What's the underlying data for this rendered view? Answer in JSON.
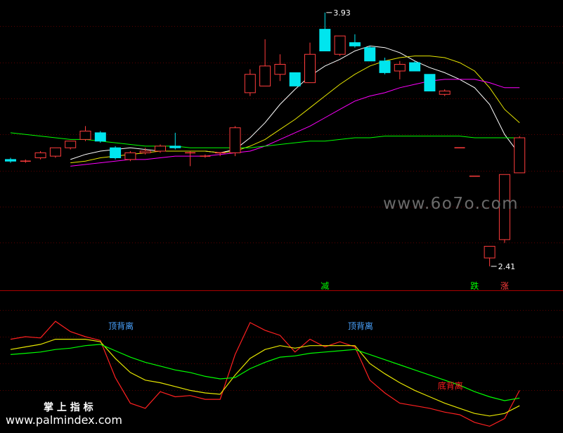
{
  "chart_data": [
    {
      "type": "candlestick",
      "title": "",
      "xlabel": "",
      "ylabel": "",
      "ylim": [
        2.3,
        3.98
      ],
      "grid": true,
      "colors": {
        "up": "#ff3c3c",
        "down": "#00e5ee",
        "background": "#000000",
        "grid": "#5a0000"
      },
      "candles": [
        {
          "o": 3.05,
          "h": 3.06,
          "l": 3.03,
          "c": 3.04
        },
        {
          "o": 3.04,
          "h": 3.05,
          "l": 3.03,
          "c": 3.04
        },
        {
          "o": 3.06,
          "h": 3.1,
          "l": 3.05,
          "c": 3.09
        },
        {
          "o": 3.07,
          "h": 3.12,
          "l": 3.06,
          "c": 3.12
        },
        {
          "o": 3.12,
          "h": 3.16,
          "l": 3.11,
          "c": 3.16
        },
        {
          "o": 3.17,
          "h": 3.25,
          "l": 3.16,
          "c": 3.22
        },
        {
          "o": 3.21,
          "h": 3.22,
          "l": 3.15,
          "c": 3.16
        },
        {
          "o": 3.12,
          "h": 3.13,
          "l": 3.05,
          "c": 3.06
        },
        {
          "o": 3.05,
          "h": 3.1,
          "l": 3.04,
          "c": 3.09
        },
        {
          "o": 3.09,
          "h": 3.12,
          "l": 3.08,
          "c": 3.1
        },
        {
          "o": 3.1,
          "h": 3.14,
          "l": 3.09,
          "c": 3.13
        },
        {
          "o": 3.13,
          "h": 3.21,
          "l": 3.11,
          "c": 3.12
        },
        {
          "o": 3.09,
          "h": 3.1,
          "l": 3.01,
          "c": 3.09
        },
        {
          "o": 3.07,
          "h": 3.08,
          "l": 3.06,
          "c": 3.07
        },
        {
          "o": 3.09,
          "h": 3.09,
          "l": 3.07,
          "c": 3.09
        },
        {
          "o": 3.09,
          "h": 3.25,
          "l": 3.07,
          "c": 3.24
        },
        {
          "o": 3.45,
          "h": 3.59,
          "l": 3.43,
          "c": 3.56
        },
        {
          "o": 3.49,
          "h": 3.77,
          "l": 3.49,
          "c": 3.61
        },
        {
          "o": 3.56,
          "h": 3.68,
          "l": 3.52,
          "c": 3.62
        },
        {
          "o": 3.57,
          "h": 3.57,
          "l": 3.49,
          "c": 3.49
        },
        {
          "o": 3.51,
          "h": 3.75,
          "l": 3.51,
          "c": 3.68
        },
        {
          "o": 3.83,
          "h": 3.93,
          "l": 3.7,
          "c": 3.7
        },
        {
          "o": 3.68,
          "h": 3.79,
          "l": 3.67,
          "c": 3.79
        },
        {
          "o": 3.75,
          "h": 3.8,
          "l": 3.72,
          "c": 3.73
        },
        {
          "o": 3.72,
          "h": 3.73,
          "l": 3.64,
          "c": 3.64
        },
        {
          "o": 3.64,
          "h": 3.66,
          "l": 3.56,
          "c": 3.57
        },
        {
          "o": 3.58,
          "h": 3.64,
          "l": 3.53,
          "c": 3.62
        },
        {
          "o": 3.63,
          "h": 3.64,
          "l": 3.58,
          "c": 3.58
        },
        {
          "o": 3.56,
          "h": 3.56,
          "l": 3.46,
          "c": 3.46
        },
        {
          "o": 3.44,
          "h": 3.47,
          "l": 3.43,
          "c": 3.46
        },
        {
          "o": 3.12,
          "h": 3.12,
          "l": 3.12,
          "c": 3.12
        },
        {
          "o": 2.95,
          "h": 2.95,
          "l": 2.95,
          "c": 2.95
        },
        {
          "o": 2.46,
          "h": 2.53,
          "l": 2.41,
          "c": 2.53
        },
        {
          "o": 2.57,
          "h": 2.96,
          "l": 2.55,
          "c": 2.96
        },
        {
          "o": 2.97,
          "h": 3.19,
          "l": 2.97,
          "c": 3.18
        }
      ],
      "series": [
        {
          "color": "#ffffff",
          "values": [
            null,
            null,
            null,
            null,
            3.05,
            3.08,
            3.1,
            3.11,
            3.12,
            3.11,
            3.1,
            3.1,
            3.1,
            3.1,
            3.09,
            3.11,
            3.18,
            3.27,
            3.38,
            3.47,
            3.55,
            3.61,
            3.65,
            3.7,
            3.73,
            3.72,
            3.69,
            3.64,
            3.6,
            3.57,
            3.53,
            3.48,
            3.38,
            3.2,
            3.08
          ]
        },
        {
          "color": "#e6e600",
          "values": [
            null,
            null,
            null,
            null,
            3.03,
            3.04,
            3.06,
            3.07,
            3.08,
            3.09,
            3.1,
            3.1,
            3.1,
            3.1,
            3.09,
            3.1,
            3.13,
            3.17,
            3.23,
            3.29,
            3.36,
            3.43,
            3.5,
            3.56,
            3.61,
            3.64,
            3.66,
            3.67,
            3.67,
            3.66,
            3.63,
            3.58,
            3.48,
            3.35,
            3.27
          ]
        },
        {
          "color": "#ff00ff",
          "values": [
            null,
            null,
            null,
            null,
            3.01,
            3.02,
            3.03,
            3.04,
            3.05,
            3.05,
            3.06,
            3.07,
            3.07,
            3.07,
            3.08,
            3.09,
            3.1,
            3.13,
            3.17,
            3.21,
            3.25,
            3.3,
            3.35,
            3.4,
            3.43,
            3.45,
            3.48,
            3.5,
            3.52,
            3.53,
            3.53,
            3.53,
            3.51,
            3.48,
            3.48
          ]
        },
        {
          "color": "#00ff00",
          "values": [
            3.21,
            3.2,
            3.19,
            3.18,
            3.17,
            3.17,
            3.16,
            3.15,
            3.14,
            3.13,
            3.13,
            3.13,
            3.12,
            3.12,
            3.12,
            3.12,
            3.12,
            3.13,
            3.14,
            3.15,
            3.16,
            3.16,
            3.17,
            3.18,
            3.18,
            3.19,
            3.19,
            3.19,
            3.19,
            3.19,
            3.19,
            3.18,
            3.18,
            3.18,
            3.18
          ]
        }
      ],
      "annotations": [
        {
          "text": "3.93",
          "index": 21,
          "value": 3.93
        },
        {
          "text": "2.41",
          "index": 32,
          "value": 2.41
        }
      ],
      "signals": [
        {
          "text": "减",
          "color": "#00ff00",
          "index": 21
        },
        {
          "text": "跌",
          "color": "#00ff00",
          "index": 31
        },
        {
          "text": "涨",
          "color": "#ff3c3c",
          "index": 33
        }
      ]
    },
    {
      "type": "line",
      "title": "",
      "xlabel": "",
      "ylabel": "",
      "ylim": [
        0,
        100
      ],
      "grid": true,
      "series": [
        {
          "color": "#ff2020",
          "values": [
            70,
            72,
            71,
            84,
            76,
            72,
            69,
            40,
            20,
            16,
            29,
            25,
            26,
            23,
            23,
            58,
            83,
            77,
            73,
            60,
            70,
            64,
            68,
            64,
            38,
            28,
            20,
            18,
            16,
            13,
            11,
            5,
            2,
            8,
            30
          ]
        },
        {
          "color": "#e6e600",
          "values": [
            62,
            64,
            66,
            70,
            70,
            70,
            68,
            55,
            44,
            38,
            36,
            33,
            30,
            28,
            27,
            42,
            55,
            62,
            65,
            63,
            65,
            65,
            65,
            65,
            51,
            43,
            36,
            30,
            25,
            20,
            16,
            12,
            10,
            12,
            18
          ]
        },
        {
          "color": "#00ff00",
          "values": [
            58,
            59,
            60,
            62,
            63,
            65,
            66,
            61,
            56,
            52,
            49,
            46,
            44,
            41,
            39,
            40,
            47,
            52,
            56,
            57,
            59,
            60,
            61,
            62,
            58,
            54,
            50,
            46,
            42,
            38,
            34,
            29,
            25,
            22,
            24
          ]
        }
      ],
      "annotations": [
        {
          "text": "顶背离",
          "color": "#4aa3ff",
          "index": 7
        },
        {
          "text": "顶背离",
          "color": "#4aa3ff",
          "index": 23
        },
        {
          "text": "底背离",
          "color": "#ff2020",
          "index": 29
        }
      ]
    }
  ],
  "watermarks": {
    "site_center": "www.6o7o.com",
    "app_name": "掌 上 指 标",
    "site_bottom": "www.palmindex.com"
  }
}
